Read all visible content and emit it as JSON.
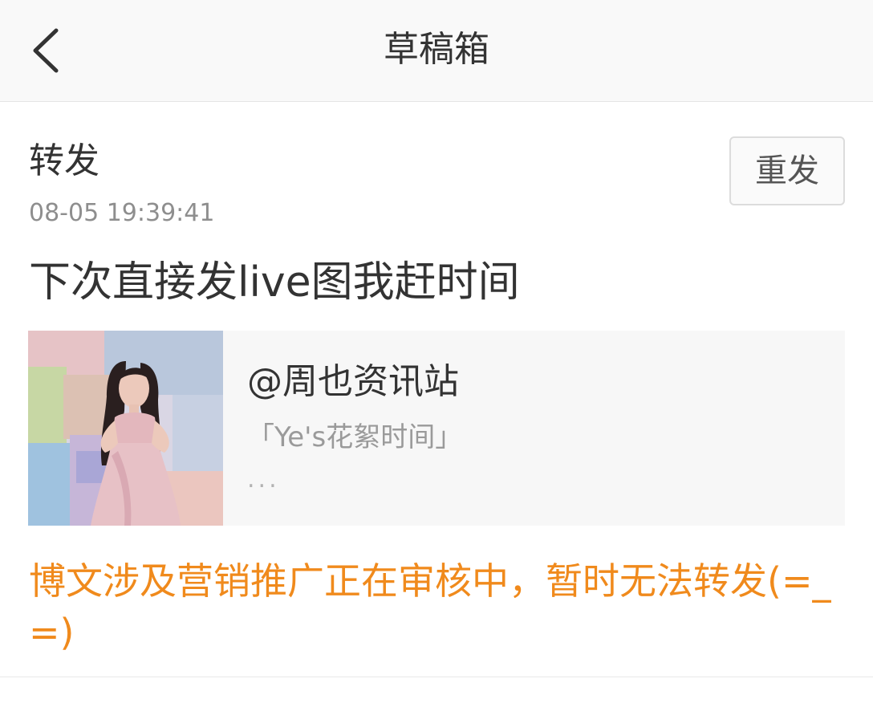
{
  "nav": {
    "title": "草稿箱",
    "back_icon": "chevron-left-icon"
  },
  "draft": {
    "type_label": "转发",
    "timestamp": "08-05 19:39:41",
    "resend_label": "重发",
    "content": "下次直接发live图我赶时间",
    "repost": {
      "author": "@周也资讯站",
      "excerpt": "「Ye's花絮时间」",
      "ellipsis": "...",
      "thumbnail": "photo of woman in pink gown against pastel background"
    },
    "notice": "博文涉及营销推广正在审核中，暂时无法转发(=_=)"
  },
  "colors": {
    "notice": "#f08a1c",
    "nav_background": "#f9f9f9",
    "card_background": "#f7f7f7",
    "timestamp": "#8e8e8e"
  }
}
